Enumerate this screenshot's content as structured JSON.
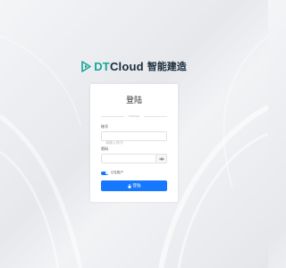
{
  "brand": {
    "name_accent": "DT",
    "name_rest": "Cloud",
    "name_cn": "智能建造",
    "logo_color": "#1aa39a"
  },
  "login_card": {
    "title": "登陆",
    "divider_text": "DTCloud",
    "account": {
      "label": "账号",
      "placeholder": "请输入账号",
      "value": ""
    },
    "password": {
      "label": "密码",
      "placeholder": "",
      "value": "",
      "toggle_icon": "eye-icon"
    },
    "remember": {
      "label": "记住账户",
      "checked": true
    },
    "submit": {
      "label": "登陆",
      "icon": "lock-icon"
    },
    "primary_color": "#1677ff"
  }
}
